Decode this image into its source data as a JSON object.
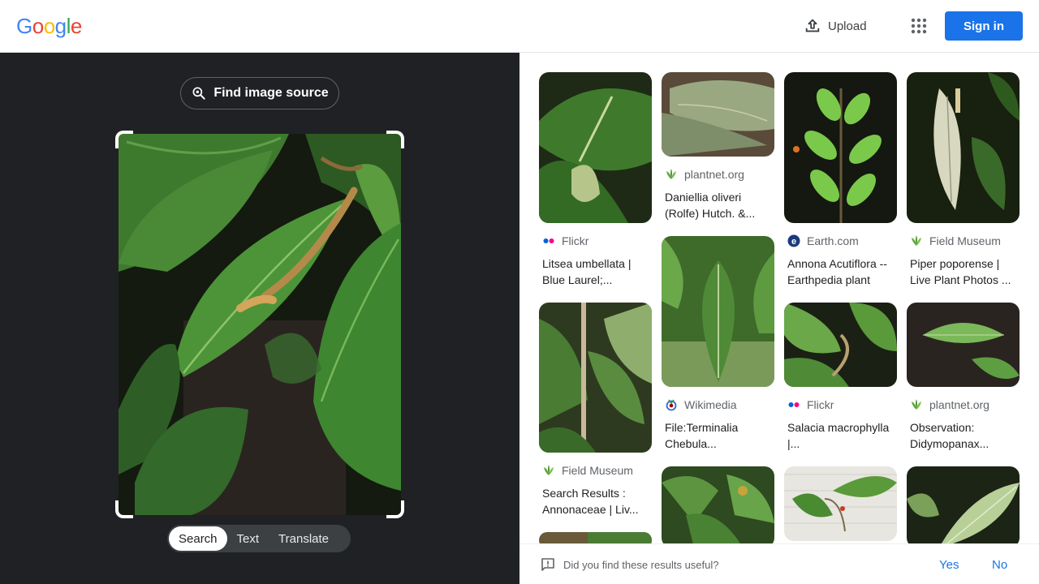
{
  "header": {
    "logo": [
      "G",
      "o",
      "o",
      "g",
      "l",
      "e"
    ],
    "logo_colors": [
      "#4285F4",
      "#EA4335",
      "#FBBC05",
      "#4285F4",
      "#34A853",
      "#EA4335"
    ],
    "upload_label": "Upload",
    "apps_icon": "apps-grid-icon",
    "signin_label": "Sign in",
    "accent": "#1a73e8"
  },
  "left_panel": {
    "find_source_label": "Find image source",
    "modes": [
      {
        "label": "Search",
        "active": true
      },
      {
        "label": "Text",
        "active": false
      },
      {
        "label": "Translate",
        "active": false
      }
    ]
  },
  "results": [
    {
      "source": "Flickr",
      "title": "Litsea umbellata | Blue Laurel;...",
      "favicon": "flickr-icon"
    },
    {
      "source": "plantnet.org",
      "title": "Daniellia oliveri (Rolfe) Hutch. &...",
      "favicon": "plantnet-icon"
    },
    {
      "source": "Earth.com",
      "title": "Annona Acutiflora -- Earthpedia plant",
      "favicon": "earth-icon"
    },
    {
      "source": "Field Museum",
      "title": "Piper poporense | Live Plant Photos ...",
      "favicon": "fieldmuseum-icon"
    },
    {
      "source": "Field Museum",
      "title": "Search Results : Annonaceae | Liv...",
      "favicon": "fieldmuseum-icon"
    },
    {
      "source": "Wikimedia",
      "title": "File:Terminalia Chebula...",
      "favicon": "wikimedia-icon"
    },
    {
      "source": "Flickr",
      "title": "Salacia macrophylla |...",
      "favicon": "flickr-icon"
    },
    {
      "source": "plantnet.org",
      "title": "Observation: Didymopanax...",
      "favicon": "plantnet-icon"
    }
  ],
  "feedback": {
    "question": "Did you find these results useful?",
    "yes": "Yes",
    "no": "No"
  }
}
